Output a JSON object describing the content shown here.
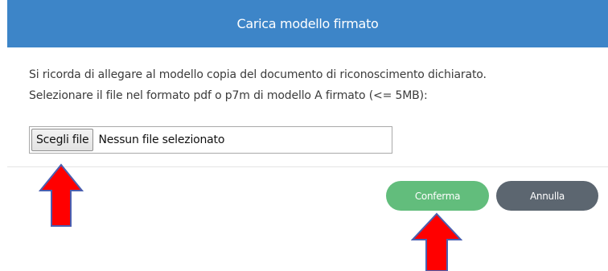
{
  "dialog": {
    "title": "Carica modello firmato",
    "line1": "Si ricorda di allegare al modello copia del documento di riconoscimento dichiarato.",
    "line2": "Selezionare il file nel formato pdf o p7m di modello A firmato (<= 5MB):"
  },
  "file_input": {
    "button_label": "Scegli file",
    "status": "Nessun file selezionato"
  },
  "buttons": {
    "confirm_label": "Conferma",
    "cancel_label": "Annulla"
  },
  "colors": {
    "header": "#3d85c8",
    "confirm": "#62bd7c",
    "cancel": "#5c6670",
    "arrow_fill": "#ff0000",
    "arrow_stroke": "#4a5fb0"
  },
  "annotations": {
    "arrow_icon": "arrow-up-icon"
  }
}
